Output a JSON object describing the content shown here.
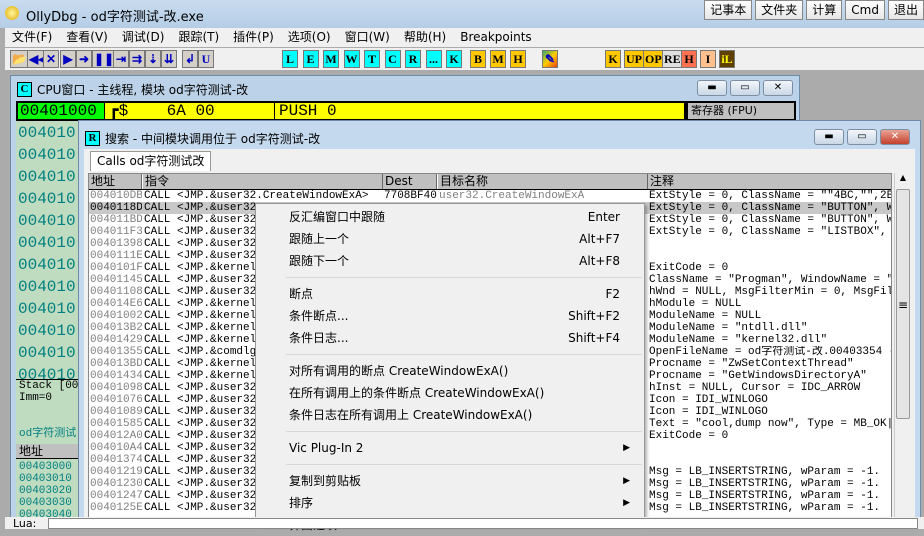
{
  "app": {
    "title": "OllyDbg - od字符测试-改.exe",
    "quick_buttons": [
      "记事本",
      "文件夹",
      "计算",
      "Cmd",
      "退出"
    ]
  },
  "menu": [
    "文件(F)",
    "查看(V)",
    "调试(D)",
    "跟踪(T)",
    "插件(P)",
    "选项(O)",
    "窗口(W)",
    "帮助(H)",
    "Breakpoints"
  ],
  "toolbar": {
    "letters_cyan": [
      "L",
      "E",
      "M",
      "W",
      "T",
      "C",
      "R",
      "...",
      "K"
    ],
    "letters_yellow": [
      "B",
      "M",
      "H"
    ],
    "plugins": [
      "K",
      "UP",
      "OP",
      "RE",
      "H",
      "I",
      "iL"
    ]
  },
  "cpu": {
    "badge": "C",
    "title": "CPU窗口 - 主线程, 模块 od字符测试-改",
    "current_addr": "00401000",
    "current_hex": "┏$    6A 00",
    "current_asm": "PUSH 0",
    "registers_header": "寄存器 (FPU)",
    "addr_rows": [
      "004010",
      "004010",
      "004010",
      "004010",
      "004010",
      "004010",
      "004010",
      "004010",
      "004010",
      "004010",
      "004010",
      "004010"
    ],
    "info": [
      "Stack [001",
      "Imm=0"
    ],
    "module_label": "od字符测试",
    "dump_header": "地址",
    "dump_rows": [
      "00403000",
      "00403010",
      "00403020",
      "00403030",
      "00403040"
    ]
  },
  "search": {
    "badge": "R",
    "title": "搜索 - 中间模块调用位于 od字符测试-改",
    "tab": "Calls od字符测试改",
    "columns": [
      "地址",
      "指令",
      "Dest",
      "目标名称",
      "注释"
    ],
    "rows": [
      [
        "004010DB",
        "CALL <JMP.&user32.CreateWindowExA>",
        "7708BF40",
        "user32.CreateWindowExA",
        "ExtStyle = 0, ClassName = \"\"4BC,\"\",2BO, W"
      ],
      [
        "0040118D",
        "CALL <JMP.&user32.",
        "",
        "",
        "ExtStyle = 0, ClassName = \"BUTTON\", Windo"
      ],
      [
        "004011BD",
        "CALL <JMP.&user32.",
        "",
        "",
        "ExtStyle = 0, ClassName = \"BUTTON\", Windo"
      ],
      [
        "004011F3",
        "CALL <JMP.&user32.",
        "",
        "",
        "ExtStyle = 0, ClassName = \"LISTBOX\", Winc"
      ],
      [
        "00401398",
        "CALL <JMP.&user32.",
        "",
        "",
        ""
      ],
      [
        "0040111E",
        "CALL <JMP.&user32.",
        "",
        "",
        ""
      ],
      [
        "0040101F",
        "CALL <JMP.&kernel3",
        "",
        "",
        "ExitCode = 0"
      ],
      [
        "00401145",
        "CALL <JMP.&user32.",
        "",
        "",
        "ClassName = \"Progman\", WindowName = \"Prog"
      ],
      [
        "00401108",
        "CALL <JMP.&user32.",
        "",
        "",
        "hWnd = NULL, MsgFilterMin = 0, MsgFilterM"
      ],
      [
        "004014E6",
        "CALL <JMP.&kernel3",
        "",
        "",
        "hModule = NULL"
      ],
      [
        "00401002",
        "CALL <JMP.&kernel3",
        "",
        "",
        "ModuleName = NULL"
      ],
      [
        "004013B2",
        "CALL <JMP.&kernel3",
        "",
        "",
        "ModuleName = \"ntdll.dll\""
      ],
      [
        "00401429",
        "CALL <JMP.&kernel3",
        "",
        "",
        "ModuleName = \"kernel32.dll\""
      ],
      [
        "00401355",
        "CALL <JMP.&comdlg3",
        "",
        "",
        "OpenFileName = od字符测试-改.00403354 ->"
      ],
      [
        "004013BD",
        "CALL <JMP.&kernel3",
        "",
        "",
        "Procname = \"ZwSetContextThread\""
      ],
      [
        "00401434",
        "CALL <JMP.&kernel3",
        "",
        "",
        "Procname = \"GetWindowsDirectoryA\""
      ],
      [
        "00401098",
        "CALL <JMP.&user32.",
        "",
        "",
        "hInst = NULL, Cursor = IDC_ARROW"
      ],
      [
        "00401076",
        "CALL <JMP.&user32.",
        "",
        "",
        "Icon = IDI_WINLOGO"
      ],
      [
        "00401089",
        "CALL <JMP.&user32.",
        "",
        "",
        "Icon = IDI_WINLOGO"
      ],
      [
        "00401585",
        "CALL <JMP.&user32.",
        "",
        "",
        "Text = \"cool,dump now\", Type = MB_OK|MB_I"
      ],
      [
        "004012A0",
        "CALL <JMP.&user32.",
        "",
        "",
        "ExitCode = 0"
      ],
      [
        "004010A4",
        "CALL <JMP.&user32.",
        "",
        "",
        ""
      ],
      [
        "00401374",
        "CALL <JMP.&user32.",
        "",
        "",
        ""
      ],
      [
        "00401219",
        "CALL <JMP.&user32.",
        "",
        "",
        "Msg = LB_INSERTSTRING, wParam = -1."
      ],
      [
        "00401230",
        "CALL <JMP.&user32.",
        "",
        "",
        "Msg = LB_INSERTSTRING, wParam = -1."
      ],
      [
        "00401247",
        "CALL <JMP.&user32.",
        "",
        "",
        "Msg = LB_INSERTSTRING, wParam = -1."
      ],
      [
        "0040125E",
        "CALL <JMP.&user32.",
        "",
        "",
        "Msg = LB_INSERTSTRING, wParam = -1."
      ]
    ],
    "selected_row": 1
  },
  "context_menu": [
    [
      {
        "label": "反汇编窗口中跟随",
        "shortcut": "Enter"
      },
      {
        "label": "跟随上一个",
        "shortcut": "Alt+F7"
      },
      {
        "label": "跟随下一个",
        "shortcut": "Alt+F8"
      }
    ],
    [
      {
        "label": "断点",
        "shortcut": "F2"
      },
      {
        "label": "条件断点...",
        "shortcut": "Shift+F2"
      },
      {
        "label": "条件日志...",
        "shortcut": "Shift+F4"
      }
    ],
    [
      {
        "label": "对所有调用的断点 CreateWindowExA()"
      },
      {
        "label": "在所有调用上的条件断点 CreateWindowExA()"
      },
      {
        "label": "条件日志在所有调用上 CreateWindowExA()"
      }
    ],
    [
      {
        "label": "Vic Plug-In 2",
        "submenu": true
      }
    ],
    [
      {
        "label": "复制到剪贴板",
        "submenu": true
      },
      {
        "label": "排序",
        "submenu": true
      },
      {
        "label": "界面选项",
        "submenu": true
      }
    ]
  ],
  "status": {
    "lua_label": "Lua:"
  }
}
